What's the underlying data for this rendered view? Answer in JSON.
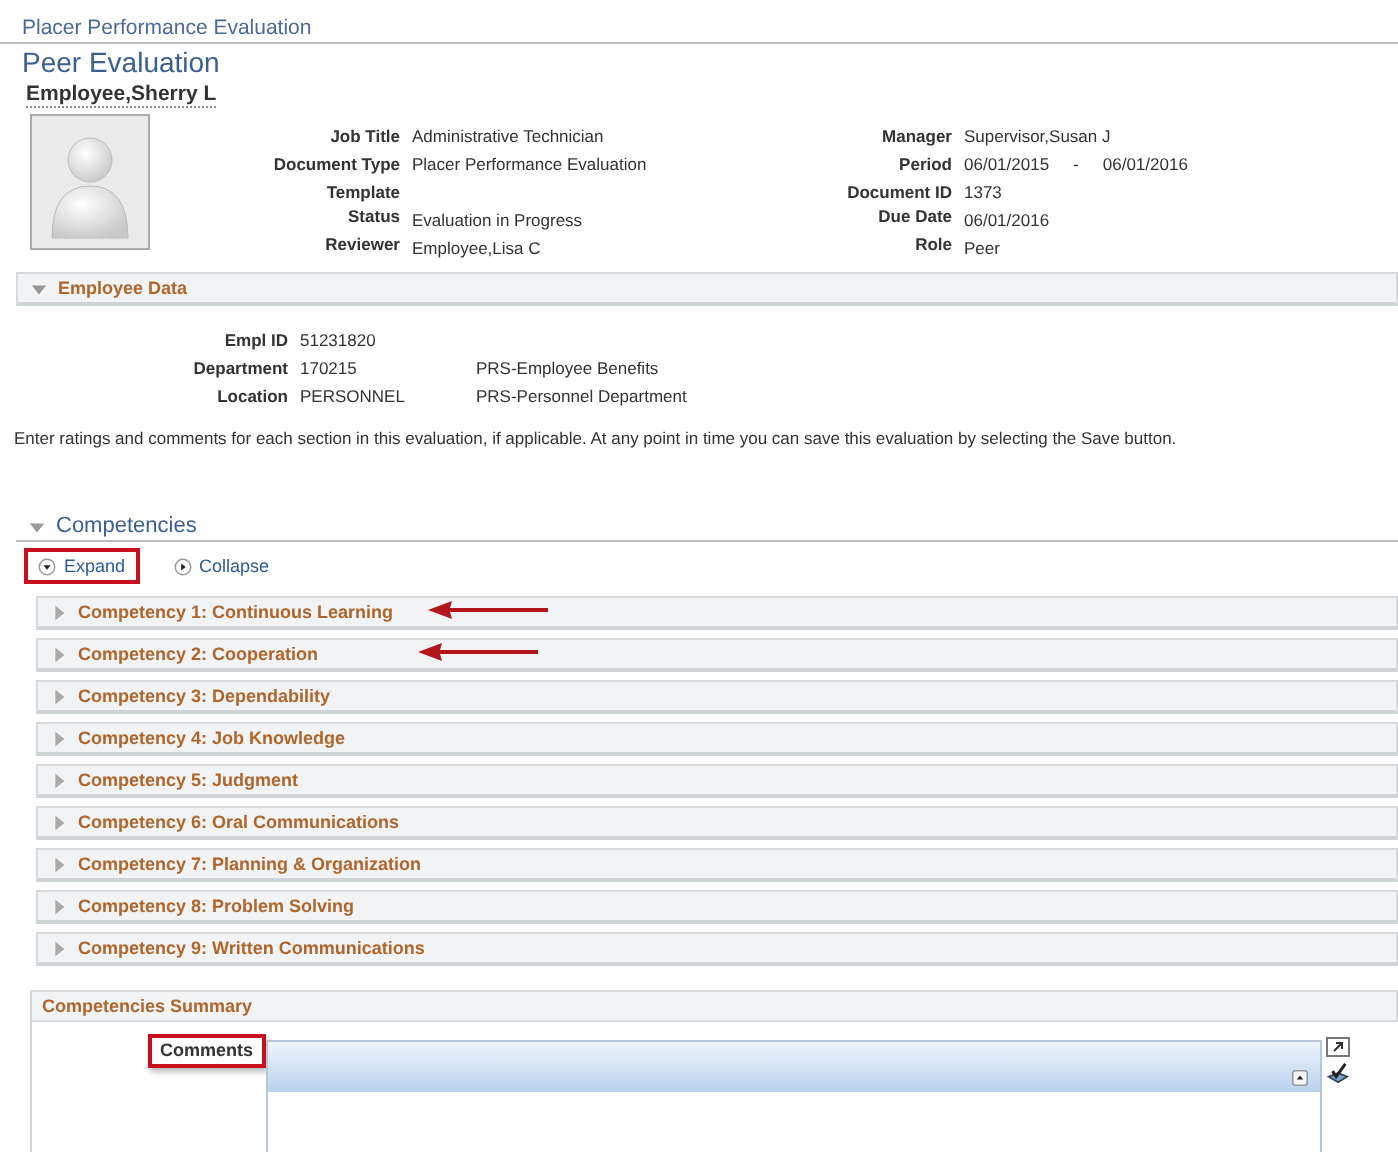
{
  "breadcrumb": "Placer Performance Evaluation",
  "page_title": "Peer Evaluation",
  "employee_name": "Employee,Sherry L",
  "header_fields_left": [
    {
      "label": "Job Title",
      "value": "Administrative Technician"
    },
    {
      "label": "Document Type",
      "value": "Placer Performance Evaluation"
    },
    {
      "label": "Template"
    },
    {
      "label": "Status",
      "value": "Evaluation in Progress"
    },
    {
      "label": "Reviewer",
      "value": "Employee,Lisa C"
    }
  ],
  "header_fields_right": [
    {
      "label": "Manager",
      "value": "Supervisor,Susan J"
    },
    {
      "label": "Period",
      "value": "06/01/2015",
      "separator": "-",
      "value_2": "06/01/2016"
    },
    {
      "label": "Document ID",
      "value": "1373"
    },
    {
      "label": "Due Date",
      "value": "06/01/2016"
    },
    {
      "label": "Role",
      "value": "Peer"
    }
  ],
  "employee_data": {
    "title": "Employee Data",
    "expanded": true,
    "fields": [
      {
        "label": "Empl ID",
        "value": "51231820"
      },
      {
        "label": "Department",
        "value": "170215",
        "description": "PRS-Employee Benefits"
      },
      {
        "label": "Location",
        "value": "PERSONNEL",
        "description": "PRS-Personnel Department"
      }
    ]
  },
  "instructions": "Enter ratings and comments for each section in this evaluation, if applicable. At any point in time you can save this evaluation by selecting the Save button.",
  "competencies": {
    "title": "Competencies",
    "expanded": true,
    "expand_link": {
      "label": "Expand",
      "highlighted": true
    },
    "collapse_link": {
      "label": "Collapse",
      "highlighted": false
    },
    "items": [
      {
        "label": "Competency 1: Continuous Learning",
        "expanded": false,
        "arrow": true
      },
      {
        "label": "Competency 2: Cooperation",
        "expanded": false,
        "arrow": true
      },
      {
        "label": "Competency 3: Dependability",
        "expanded": false,
        "arrow": false
      },
      {
        "label": "Competency 4: Job Knowledge",
        "expanded": false,
        "arrow": false
      },
      {
        "label": "Competency 5: Judgment",
        "expanded": false,
        "arrow": false
      },
      {
        "label": "Competency 6: Oral Communications",
        "expanded": false,
        "arrow": false
      },
      {
        "label": "Competency 7: Planning & Organization",
        "expanded": false,
        "arrow": false
      },
      {
        "label": "Competency 8: Problem Solving",
        "expanded": false,
        "arrow": false
      },
      {
        "label": "Competency 9: Written Communications",
        "expanded": false,
        "arrow": false
      }
    ]
  },
  "competencies_summary": {
    "title": "Competencies Summary",
    "comments_label": "Comments",
    "comments_highlighted": true
  }
}
